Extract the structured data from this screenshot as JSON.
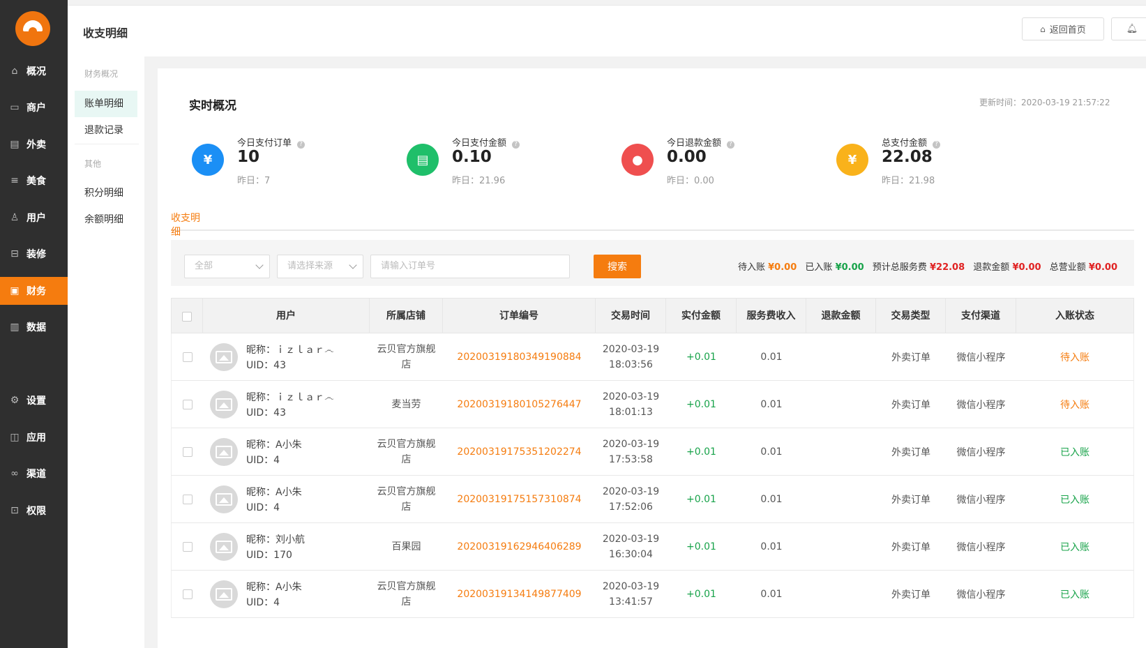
{
  "sidebar": {
    "items": [
      {
        "label": "概况",
        "icon": "home-icon"
      },
      {
        "label": "商户",
        "icon": "store-icon"
      },
      {
        "label": "外卖",
        "icon": "document-icon"
      },
      {
        "label": "美食",
        "icon": "menu-icon"
      },
      {
        "label": "用户",
        "icon": "user-icon"
      },
      {
        "label": "装修",
        "icon": "shop-decor-icon"
      },
      {
        "label": "财务",
        "icon": "wallet-icon",
        "active": true
      },
      {
        "label": "数据",
        "icon": "bar-chart-icon"
      },
      {
        "label": "设置",
        "icon": "gear-icon"
      },
      {
        "label": "应用",
        "icon": "apps-icon"
      },
      {
        "label": "渠道",
        "icon": "link-icon"
      },
      {
        "label": "权限",
        "icon": "lock-icon"
      }
    ]
  },
  "header": {
    "title": "收支明细",
    "home_button": "返回首页"
  },
  "subnav": {
    "group1": "财务概况",
    "item1": "账单明细",
    "item2": "退款记录",
    "group2": "其他",
    "item3": "积分明细",
    "item4": "余额明细"
  },
  "overview": {
    "title": "实时概况",
    "update_time": "更新时间：2020-03-19 21:57:22",
    "stats": [
      {
        "label": "今日支付订单",
        "value": "10",
        "yesterday": "昨日：7",
        "color": "#1b8ff5",
        "icon": "money-bag-icon"
      },
      {
        "label": "今日支付金额",
        "value": "0.10",
        "yesterday": "昨日：21.96",
        "color": "#1fbf6a",
        "icon": "shop-icon"
      },
      {
        "label": "今日退款金额",
        "value": "0.00",
        "yesterday": "昨日：0.00",
        "color": "#ef4f4f",
        "icon": "user-icon"
      },
      {
        "label": "总支付金额",
        "value": "22.08",
        "yesterday": "昨日：21.98",
        "color": "#f9b21b",
        "icon": "money-bag-icon"
      }
    ]
  },
  "tabs": {
    "active": "收支明细"
  },
  "filter": {
    "select_all": "全部",
    "select_source_placeholder": "请选择来源",
    "order_placeholder": "请输入订单号",
    "search_button": "搜索",
    "summary": {
      "pending_label": "待入账",
      "pending_value": "¥0.00",
      "received_label": "已入账",
      "received_value": "¥0.00",
      "fee_label": "预计总服务费",
      "fee_value": "¥22.08",
      "refund_label": "退款金额",
      "refund_value": "¥0.00",
      "revenue_label": "总营业额",
      "revenue_value": "¥0.00"
    }
  },
  "table": {
    "headers": [
      "用户",
      "所属店铺",
      "订单编号",
      "交易时间",
      "实付金额",
      "服务费收入",
      "退款金额",
      "交易类型",
      "支付渠道",
      "入账状态"
    ],
    "rows": [
      {
        "nickname": "昵称：ｉｚｌａｒ෴",
        "uid": "UID：43",
        "store1": "云贝官方旗舰",
        "store2": "店",
        "order": "20200319180349190884",
        "date": "2020-03-19",
        "time": "18:03:56",
        "paid": "+0.01",
        "fee": "0.01",
        "refund": "",
        "type": "外卖订单",
        "channel": "微信小程序",
        "status": "待入账",
        "status_kind": "wait"
      },
      {
        "nickname": "昵称：ｉｚｌａｒ෴",
        "uid": "UID：43",
        "store1": "麦当劳",
        "store2": "",
        "order": "20200319180105276447",
        "date": "2020-03-19",
        "time": "18:01:13",
        "paid": "+0.01",
        "fee": "0.01",
        "refund": "",
        "type": "外卖订单",
        "channel": "微信小程序",
        "status": "待入账",
        "status_kind": "wait"
      },
      {
        "nickname": "昵称：A小朱",
        "uid": "UID：4",
        "store1": "云贝官方旗舰",
        "store2": "店",
        "order": "20200319175351202274",
        "date": "2020-03-19",
        "time": "17:53:58",
        "paid": "+0.01",
        "fee": "0.01",
        "refund": "",
        "type": "外卖订单",
        "channel": "微信小程序",
        "status": "已入账",
        "status_kind": "done"
      },
      {
        "nickname": "昵称：A小朱",
        "uid": "UID：4",
        "store1": "云贝官方旗舰",
        "store2": "店",
        "order": "20200319175157310874",
        "date": "2020-03-19",
        "time": "17:52:06",
        "paid": "+0.01",
        "fee": "0.01",
        "refund": "",
        "type": "外卖订单",
        "channel": "微信小程序",
        "status": "已入账",
        "status_kind": "done"
      },
      {
        "nickname": "昵称：刘小航",
        "uid": "UID：170",
        "store1": "百果园",
        "store2": "",
        "order": "20200319162946406289",
        "date": "2020-03-19",
        "time": "16:30:04",
        "paid": "+0.01",
        "fee": "0.01",
        "refund": "",
        "type": "外卖订单",
        "channel": "微信小程序",
        "status": "已入账",
        "status_kind": "done"
      },
      {
        "nickname": "昵称：A小朱",
        "uid": "UID：4",
        "store1": "云贝官方旗舰",
        "store2": "店",
        "order": "20200319134149877409",
        "date": "2020-03-19",
        "time": "13:41:57",
        "paid": "+0.01",
        "fee": "0.01",
        "refund": "",
        "type": "外卖订单",
        "channel": "微信小程序",
        "status": "已入账",
        "status_kind": "done"
      }
    ]
  }
}
